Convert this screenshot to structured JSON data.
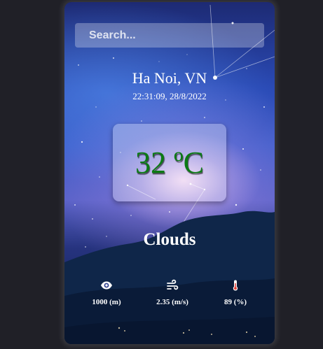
{
  "search": {
    "placeholder": "Search..."
  },
  "location": {
    "city": "Ha Noi, VN"
  },
  "datetime": "22:31:09, 28/8/2022",
  "temperature": "32 ºC",
  "condition": "Clouds",
  "stats": [
    {
      "icon": "visibility-eye-icon",
      "value": "1000 (m)"
    },
    {
      "icon": "wind-icon",
      "value": "2.35 (m/s)"
    },
    {
      "icon": "thermometer-icon",
      "value": "89 (%)"
    }
  ],
  "colors": {
    "page_background": "#202027",
    "temperature_text": "#0b7a14",
    "text": "#ffffff"
  }
}
